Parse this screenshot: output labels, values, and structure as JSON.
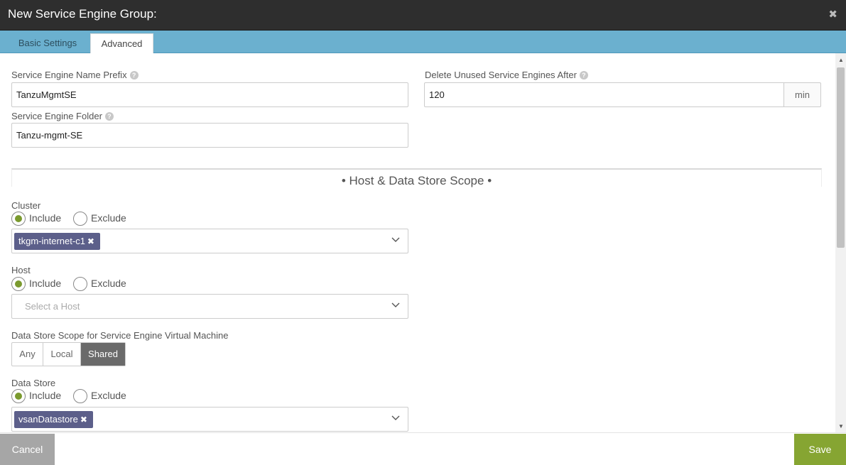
{
  "window": {
    "title": "New Service Engine Group:",
    "close_icon": "close-icon"
  },
  "tabs": [
    {
      "label": "Basic Settings",
      "active": false
    },
    {
      "label": "Advanced",
      "active": true
    }
  ],
  "fields": {
    "name_prefix": {
      "label": "Service Engine Name Prefix",
      "value": "TanzuMgmtSE"
    },
    "folder": {
      "label": "Service Engine Folder",
      "value": "Tanzu-mgmt-SE"
    },
    "delete_unused": {
      "label": "Delete Unused Service Engines After",
      "value": "120",
      "unit": "min"
    }
  },
  "section": {
    "title": "• Host & Data Store Scope •"
  },
  "cluster": {
    "label": "Cluster",
    "include_label": "Include",
    "exclude_label": "Exclude",
    "selected_mode": "Include",
    "chips": [
      "tkgm-internet-c1"
    ]
  },
  "host": {
    "label": "Host",
    "include_label": "Include",
    "exclude_label": "Exclude",
    "selected_mode": "Include",
    "placeholder": "Select a Host"
  },
  "datastore_scope": {
    "label": "Data Store Scope for Service Engine Virtual Machine",
    "options": [
      "Any",
      "Local",
      "Shared"
    ],
    "selected": "Shared"
  },
  "datastore": {
    "label": "Data Store",
    "include_label": "Include",
    "exclude_label": "Exclude",
    "selected_mode": "Include",
    "chips": [
      "vsanDatastore"
    ]
  },
  "footer": {
    "cancel_label": "Cancel",
    "save_label": "Save"
  },
  "colors": {
    "titlebar": "#2e2e2e",
    "tabbar": "#6bb0cf",
    "accent_green": "#86a532",
    "chip": "#5c5f8a",
    "segment_selected": "#6a6a6a"
  }
}
